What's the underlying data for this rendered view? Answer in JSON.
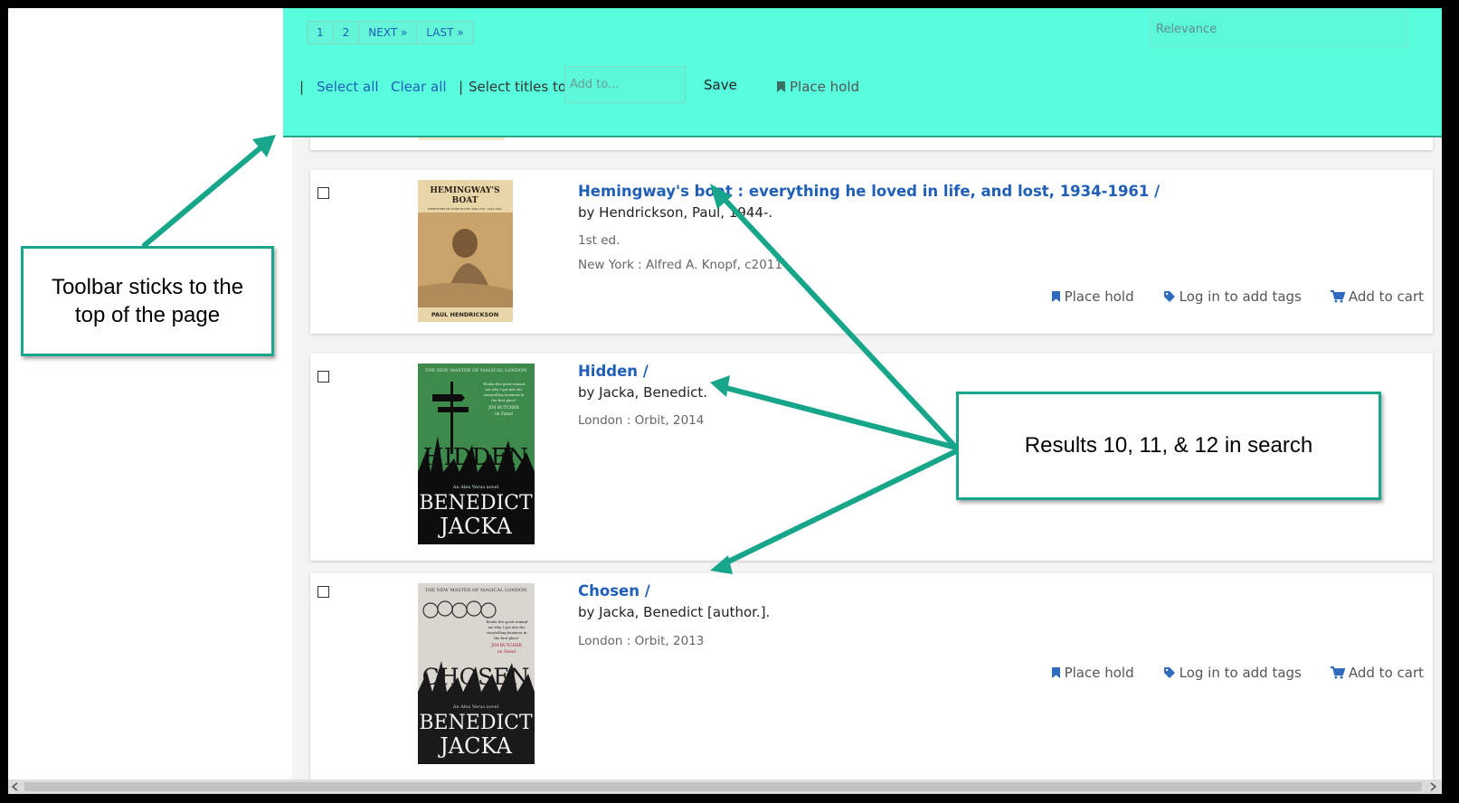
{
  "toolbar": {
    "pager": [
      "1",
      "2",
      "NEXT »",
      "LAST »"
    ],
    "sort_placeholder": "Relevance",
    "separator": "|",
    "select_all": "Select all",
    "clear_all": "Clear all",
    "select_titles_label": "Select titles to:",
    "add_to_placeholder": "Add to...",
    "save_label": "Save",
    "place_hold_label": "Place hold"
  },
  "results": [
    {
      "title": "Hemingway's boat : everything he loved in life, and lost, 1934-1961 /",
      "author": "by Hendrickson, Paul, 1944-.",
      "edition": "1st ed.",
      "publisher": "New York : Alfred A. Knopf, c2011",
      "cover": {
        "line1": "HEMINGWAY'S",
        "line2": "BOAT",
        "tagline": "EVERYTHING HE LOVED IN LIFE, AND LOST, 1934-1961",
        "author": "PAUL HENDRICKSON"
      },
      "actions": {
        "place_hold": "Place hold",
        "tags": "Log in to add tags",
        "cart": "Add to cart"
      }
    },
    {
      "title": "Hidden /",
      "author": "by Jacka, Benedict.",
      "publisher": "London : Orbit, 2014",
      "cover": {
        "top": "THE NEW MASTER OF MAGICAL LONDON",
        "blurb1": "'Books this good remind",
        "blurb2": "me why I got into the",
        "blurb3": "storytelling business in",
        "blurb4": "the first place'",
        "blurb5": "JIM BUTCHER",
        "blurb6": "on Fated",
        "word": "HIDDEN",
        "series": "An Alex Verus novel",
        "author1": "BENEDICT",
        "author2": "JACKA"
      }
    },
    {
      "title": "Chosen /",
      "author": "by Jacka, Benedict [author.].",
      "publisher": "London : Orbit, 2013",
      "cover": {
        "top": "THE NEW MASTER OF MAGICAL LONDON",
        "blurb1": "'Books this good remind",
        "blurb2": "me why I got into the",
        "blurb3": "storytelling business in",
        "blurb4": "the first place'",
        "blurb5": "JIM BUTCHER",
        "blurb6": "on Fated",
        "word": "CHOSEN",
        "series": "An Alex Verus novel",
        "author1": "BENEDICT",
        "author2": "JACKA"
      },
      "actions": {
        "place_hold": "Place hold",
        "tags": "Log in to add tags",
        "cart": "Add to cart"
      }
    }
  ],
  "callouts": {
    "toolbar_note": "Toolbar sticks to the top of the page",
    "results_note": "Results 10, 11, & 12 in search"
  },
  "colors": {
    "toolbar_bg": "#58fddd",
    "link_blue": "#1f5fb8",
    "callout_border": "#17a68a"
  }
}
